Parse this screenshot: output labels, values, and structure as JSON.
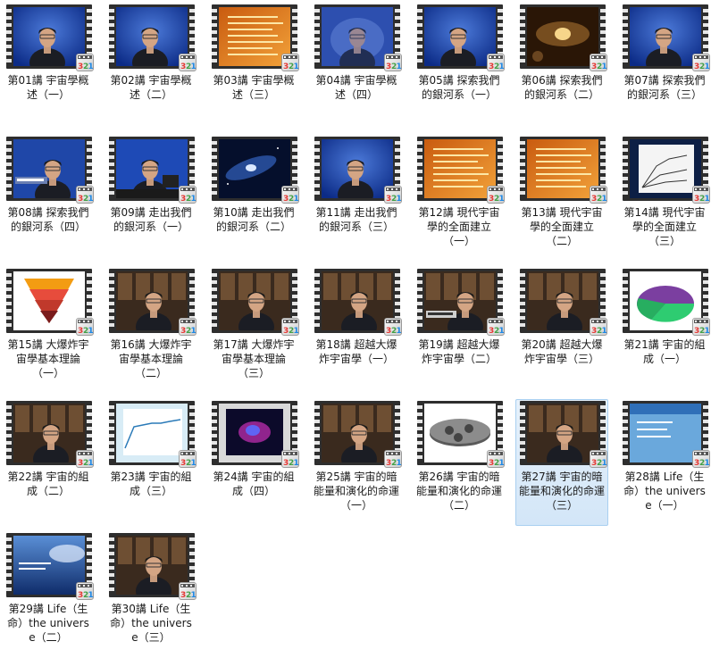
{
  "folder": {
    "items": [
      {
        "label": "第01講 宇宙學概述（一）",
        "thumb": "lecturer"
      },
      {
        "label": "第02講 宇宙學概述（二）",
        "thumb": "lecturer"
      },
      {
        "label": "第03講 宇宙學概述（三）",
        "thumb": "orange-text"
      },
      {
        "label": "第04講 宇宙學概述（四）",
        "thumb": "lecturer-blur"
      },
      {
        "label": "第05講 探索我們的銀河系（一）",
        "thumb": "lecturer"
      },
      {
        "label": "第06講 探索我們的銀河系（二）",
        "thumb": "galaxy-gold"
      },
      {
        "label": "第07講 探索我們的銀河系（三）",
        "thumb": "lecturer"
      },
      {
        "label": "第08講 探索我們的銀河系（四）",
        "thumb": "lecturer-caption"
      },
      {
        "label": "第09講 走出我們的銀河系（一）",
        "thumb": "lecturer-desk"
      },
      {
        "label": "第10講 走出我們的銀河系（二）",
        "thumb": "galaxy-blue"
      },
      {
        "label": "第11講 走出我們的銀河系（三）",
        "thumb": "lecturer"
      },
      {
        "label": "第12講 現代宇宙學的全面建立（一）",
        "thumb": "orange-text"
      },
      {
        "label": "第13講 現代宇宙學的全面建立（二）",
        "thumb": "orange-text"
      },
      {
        "label": "第14講 現代宇宙學的全面建立（三）",
        "thumb": "graph-dark"
      },
      {
        "label": "第15講 大爆炸宇宙學基本理論（一）",
        "thumb": "bigbang"
      },
      {
        "label": "第16講 大爆炸宇宙學基本理論（二）",
        "thumb": "library"
      },
      {
        "label": "第17講 大爆炸宇宙學基本理論（三）",
        "thumb": "library"
      },
      {
        "label": "第18講 超越大爆炸宇宙學（一）",
        "thumb": "library"
      },
      {
        "label": "第19講 超越大爆炸宇宙學（二）",
        "thumb": "library-caption"
      },
      {
        "label": "第20講 超越大爆炸宇宙學（三）",
        "thumb": "library"
      },
      {
        "label": "第21講 宇宙的組成（一）",
        "thumb": "pie"
      },
      {
        "label": "第22講 宇宙的組成（二）",
        "thumb": "library"
      },
      {
        "label": "第23講 宇宙的組成（三）",
        "thumb": "chart-light"
      },
      {
        "label": "第24講 宇宙的組成（四）",
        "thumb": "nebula"
      },
      {
        "label": "第25講 宇宙的暗能量和演化的命運（一）",
        "thumb": "library"
      },
      {
        "label": "第26講 宇宙的暗能量和演化的命運（二）",
        "thumb": "surface"
      },
      {
        "label": "第27講 宇宙的暗能量和演化的命運（三）",
        "thumb": "library"
      },
      {
        "label": "第28講 Life（生命）the universe（一）",
        "thumb": "blue-slide"
      },
      {
        "label": "第29講 Life（生命）the universe（二）",
        "thumb": "sky-slide"
      },
      {
        "label": "第30講 Life（生命）the universe（三）",
        "thumb": "library"
      }
    ],
    "selected_index": 26,
    "badge": {
      "text": "321",
      "colors": [
        "#e53935",
        "#43a047",
        "#1e88e5"
      ]
    }
  }
}
